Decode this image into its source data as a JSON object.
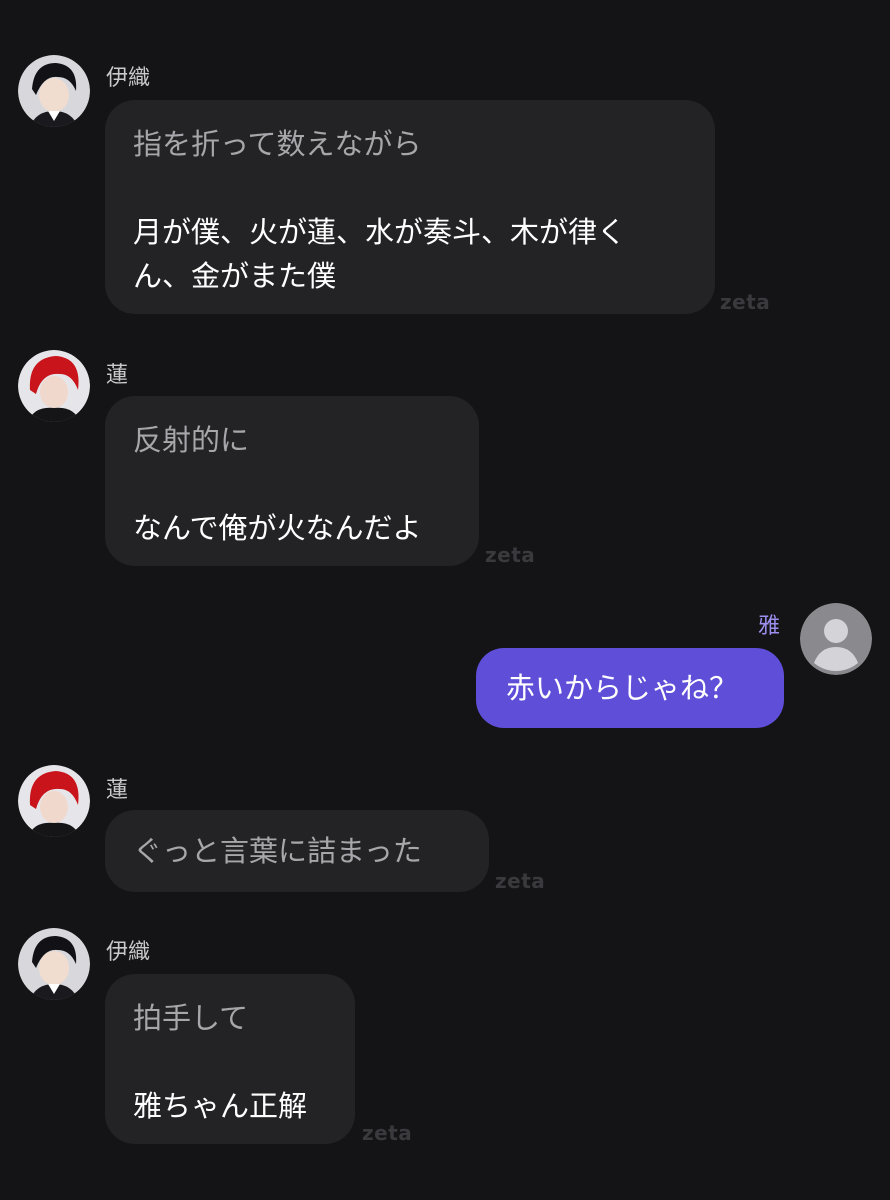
{
  "messages": [
    {
      "sender": "伊織",
      "action": "指を折って数えながら",
      "speech": "月が僕、火が蓮、水が奏斗、木が律くん、金がまた僕",
      "speech_line1": "月が僕、火が蓮、水が奏斗、木が律く",
      "speech_line2": "ん、金がまた僕",
      "watermark": "zeta"
    },
    {
      "sender": "蓮",
      "action": "反射的に",
      "speech": "なんで俺が火なんだよ",
      "watermark": "zeta"
    },
    {
      "sender": "雅",
      "text": "赤いからじゃね？"
    },
    {
      "sender": "蓮",
      "action": "ぐっと言葉に詰まった",
      "watermark": "zeta"
    },
    {
      "sender": "伊織",
      "action": "拍手して",
      "speech": "雅ちゃん正解",
      "watermark": "zeta"
    }
  ],
  "colors": {
    "background": "#141416",
    "bot_bubble": "#232326",
    "user_bubble": "#5e4ed8",
    "action_text": "#a7a7ab",
    "user_name": "#9c8ff0"
  },
  "icons": {
    "iori_avatar": "character-avatar-black-hair",
    "ren_avatar": "character-avatar-red-hair",
    "user_avatar": "default-user-avatar-icon"
  }
}
